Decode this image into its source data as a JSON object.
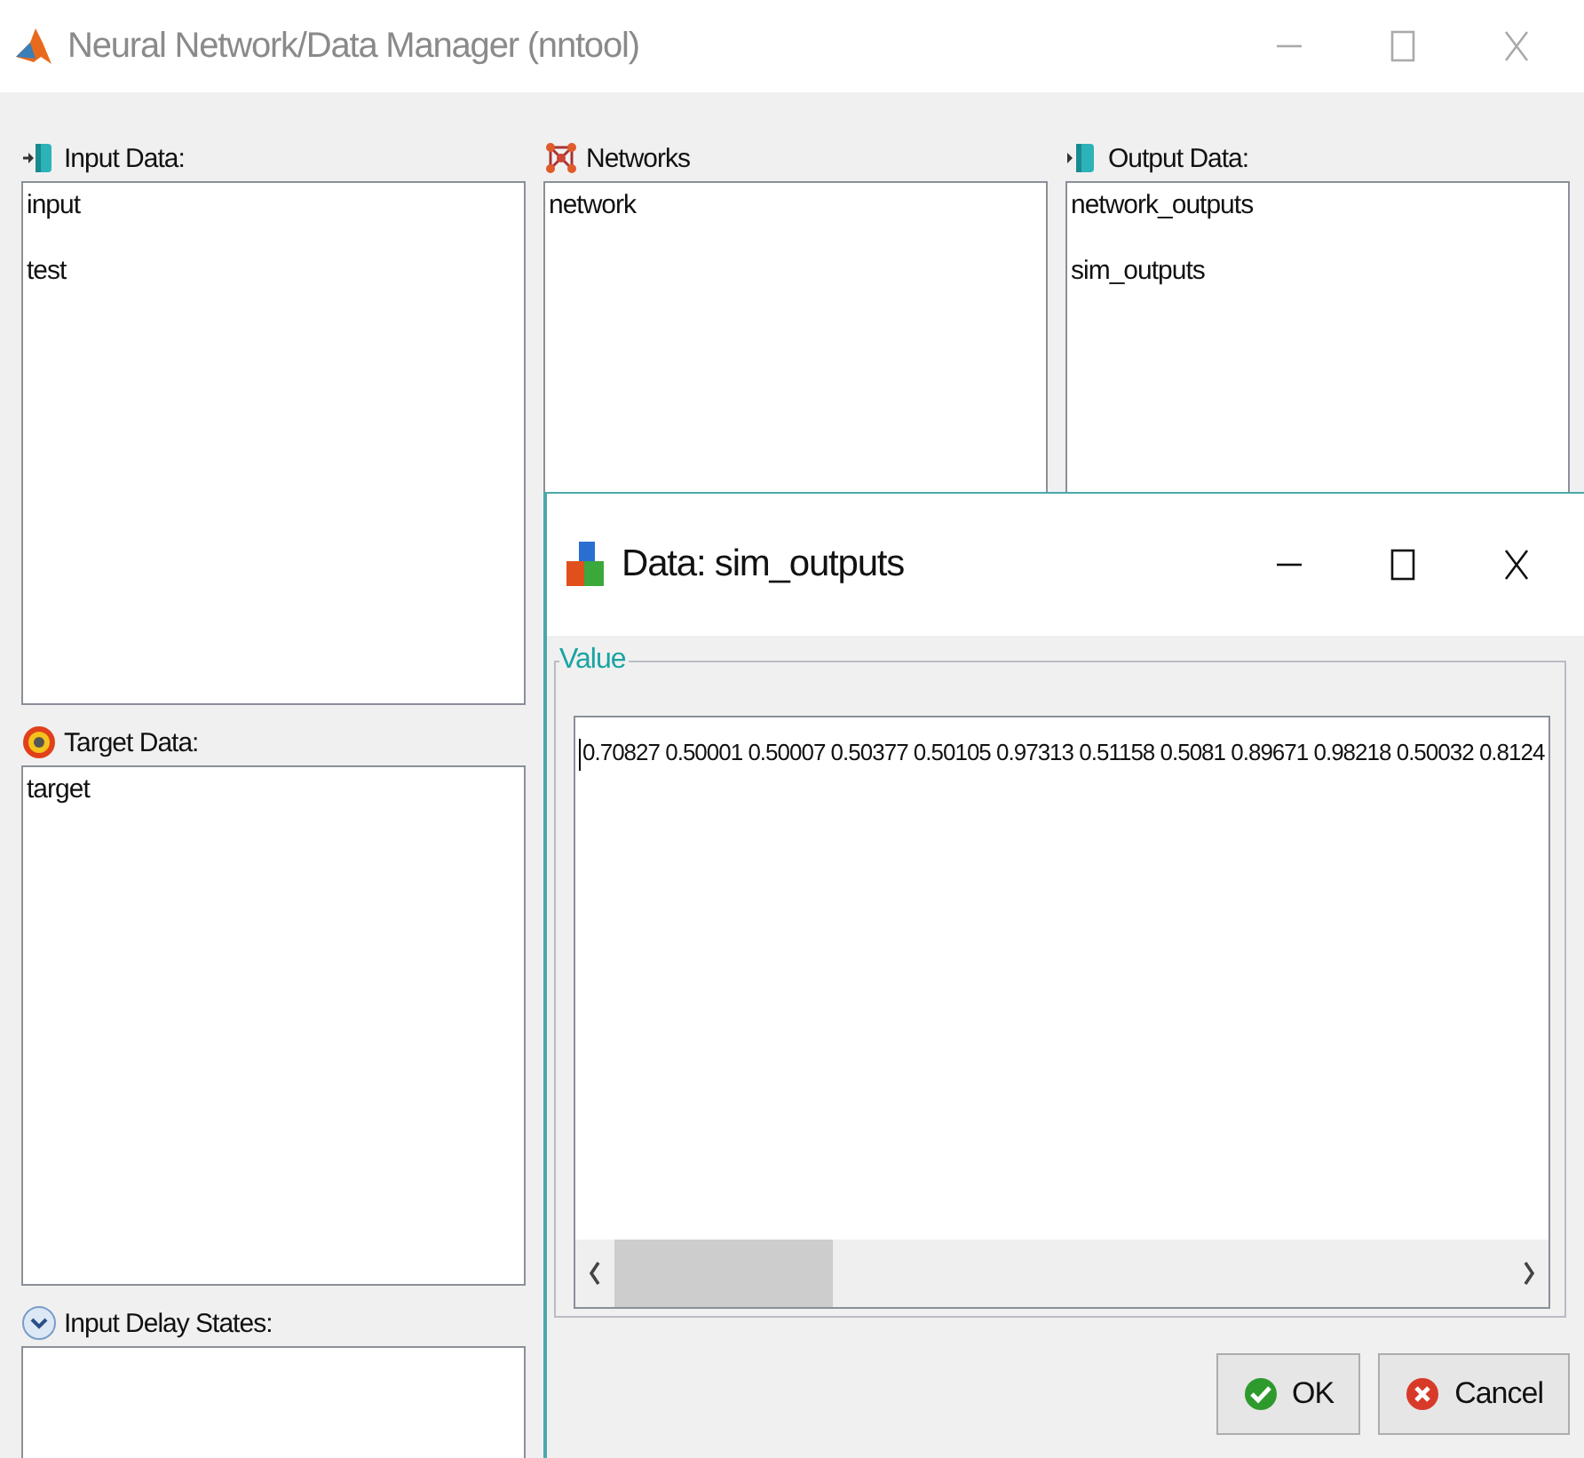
{
  "window": {
    "title": "Neural Network/Data Manager (nntool)"
  },
  "panels": [
    {
      "kind": "input",
      "label": "Input Data:",
      "items": [
        "input",
        "test"
      ]
    },
    {
      "kind": "network",
      "label": "Networks",
      "items": [
        "network"
      ]
    },
    {
      "kind": "output",
      "label": "Output Data:",
      "items": [
        "network_outputs",
        "sim_outputs"
      ]
    },
    {
      "kind": "target",
      "label": "Target Data:",
      "items": [
        "target"
      ]
    },
    {
      "kind": "delay",
      "label": "Input Delay States:"
    }
  ],
  "dialog": {
    "title": "Data: sim_outputs",
    "group_label": "Value",
    "value": "0.70827 0.50001 0.50007 0.50377 0.50105 0.97313 0.51158 0.5081 0.89671 0.98218 0.50032 0.8124",
    "buttons": [
      {
        "kind": "ok",
        "label": "OK"
      },
      {
        "kind": "cancel",
        "label": "Cancel"
      }
    ]
  }
}
